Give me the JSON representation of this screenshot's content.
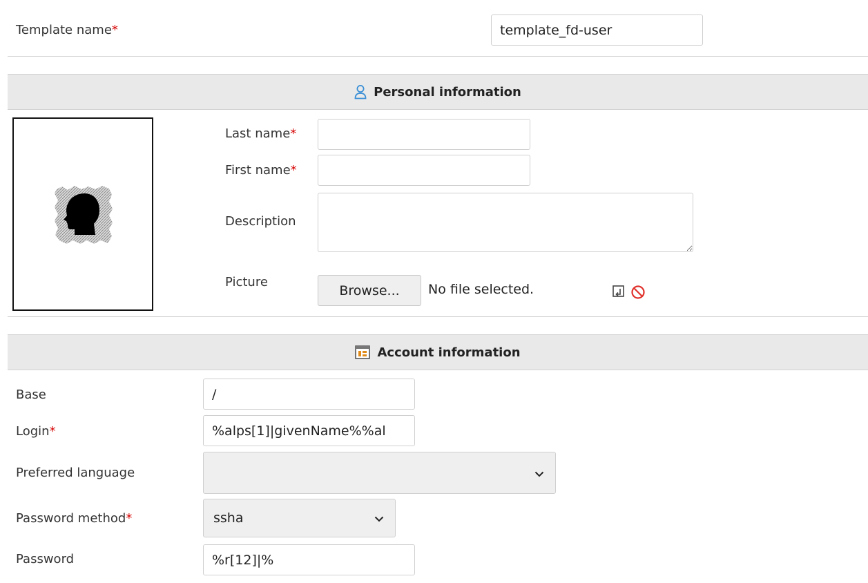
{
  "template": {
    "label": "Template name",
    "required_mark": "*",
    "value": "template_fd-user"
  },
  "personal": {
    "section_title": "Personal information",
    "last_name_label": "Last name",
    "first_name_label": "First name",
    "description_label": "Description",
    "picture_label": "Picture",
    "browse_label": "Browse...",
    "no_file_text": "No file selected.",
    "required_mark": "*",
    "last_name_value": "",
    "first_name_value": "",
    "description_value": ""
  },
  "account": {
    "section_title": "Account information",
    "base_label": "Base",
    "base_value": "/",
    "login_label": "Login",
    "login_value": "%alps[1]|givenName%%al",
    "preferred_language_label": "Preferred language",
    "preferred_language_value": "",
    "password_method_label": "Password method",
    "password_method_value": "ssha",
    "password_label": "Password",
    "password_value": "%r[12]|%",
    "required_mark": "*"
  },
  "colors": {
    "required": "#d60000",
    "section_bar": "#e9e9e9",
    "person_icon": "#3a8fd6",
    "account_icon": "#e08a1a",
    "remove_icon": "#e0302a"
  },
  "icons": {
    "personal_section": "person-icon",
    "account_section": "account-card-icon",
    "upload": "upload-picture-icon",
    "remove": "remove-picture-icon",
    "select_arrow": "chevron-down-icon"
  }
}
